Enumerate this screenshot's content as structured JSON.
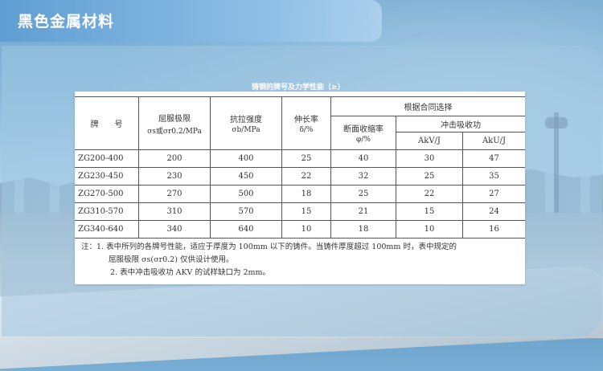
{
  "title": "黑色金属材料",
  "table_title": "铸钢的牌号及力学性能（≥）",
  "headers": {
    "grade": "牌　　号",
    "yield_main": "屈服极限",
    "yield_sub": "σs或σr0.2/MPa",
    "tensile_main": "抗拉强度",
    "tensile_sub": "σb/MPa",
    "elong_main": "伸长率",
    "elong_sub": "δ/%",
    "contract_group": "根据合同选择",
    "reduction_main": "断面收缩率",
    "reduction_sub": "φ/%",
    "impact_group": "冲击吸收功",
    "akv": "AkV/J",
    "aku": "AkU/J"
  },
  "rows": [
    {
      "grade": "ZG200-400",
      "yield": "200",
      "tensile": "400",
      "elong": "25",
      "reduction": "40",
      "akv": "30",
      "aku": "47"
    },
    {
      "grade": "ZG230-450",
      "yield": "230",
      "tensile": "450",
      "elong": "22",
      "reduction": "32",
      "akv": "25",
      "aku": "35"
    },
    {
      "grade": "ZG270-500",
      "yield": "270",
      "tensile": "500",
      "elong": "18",
      "reduction": "25",
      "akv": "22",
      "aku": "27"
    },
    {
      "grade": "ZG310-570",
      "yield": "310",
      "tensile": "570",
      "elong": "15",
      "reduction": "21",
      "akv": "15",
      "aku": "24"
    },
    {
      "grade": "ZG340-640",
      "yield": "340",
      "tensile": "640",
      "elong": "10",
      "reduction": "18",
      "akv": "10",
      "aku": "16"
    }
  ],
  "notes": {
    "line1": "注：1. 表中所列的各牌号性能，适应于厚度为 100mm 以下的铸件。当铸件厚度超过 100mm 时，表中规定的",
    "line2": "屈服极限 σs(σr0.2) 仅供设计使用。",
    "line3": "2. 表中冲击吸收功 AKV 的试样缺口为 2mm。"
  }
}
